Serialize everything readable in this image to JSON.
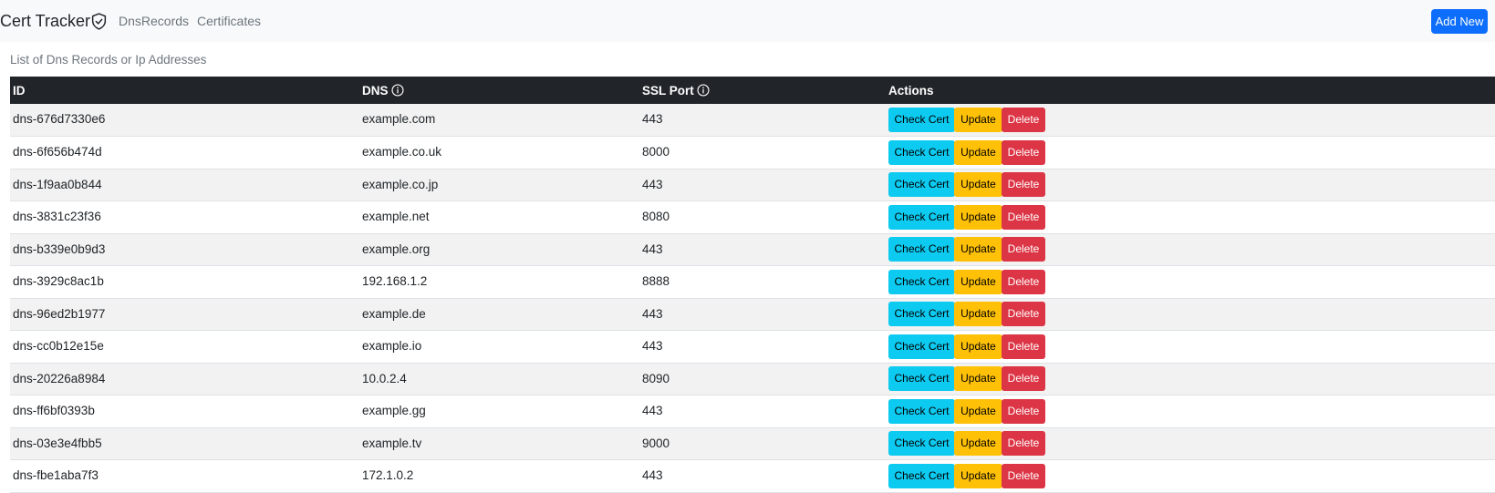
{
  "navbar": {
    "brand": "Cert Tracker",
    "brand_icon": "shield-check-icon",
    "links": [
      "DnsRecords",
      "Certificates"
    ],
    "add_new_label": "Add New"
  },
  "caption": "List of Dns Records or Ip Addresses",
  "table": {
    "headers": {
      "id": "ID",
      "dns": "DNS",
      "ssl_port": "SSL Port",
      "actions": "Actions"
    },
    "header_icons": {
      "dns": "info-circle-icon",
      "ssl_port": "info-circle-icon"
    },
    "action_labels": {
      "check": "Check Cert",
      "update": "Update",
      "delete": "Delete"
    },
    "rows": [
      {
        "id": "dns-676d7330e6",
        "dns": "example.com",
        "port": "443"
      },
      {
        "id": "dns-6f656b474d",
        "dns": "example.co.uk",
        "port": "8000"
      },
      {
        "id": "dns-1f9aa0b844",
        "dns": "example.co.jp",
        "port": "443"
      },
      {
        "id": "dns-3831c23f36",
        "dns": "example.net",
        "port": "8080"
      },
      {
        "id": "dns-b339e0b9d3",
        "dns": "example.org",
        "port": "443"
      },
      {
        "id": "dns-3929c8ac1b",
        "dns": "192.168.1.2",
        "port": "8888"
      },
      {
        "id": "dns-96ed2b1977",
        "dns": "example.de",
        "port": "443"
      },
      {
        "id": "dns-cc0b12e15e",
        "dns": "example.io",
        "port": "443"
      },
      {
        "id": "dns-20226a8984",
        "dns": "10.0.2.4",
        "port": "8090"
      },
      {
        "id": "dns-ff6bf0393b",
        "dns": "example.gg",
        "port": "443"
      },
      {
        "id": "dns-03e3e4fbb5",
        "dns": "example.tv",
        "port": "9000"
      },
      {
        "id": "dns-fbe1aba7f3",
        "dns": "172.1.0.2",
        "port": "443"
      }
    ]
  },
  "colors": {
    "primary": "#0d6efd",
    "info": "#0dcaf0",
    "warning": "#ffc107",
    "danger": "#dc3545",
    "table_header": "#212529"
  }
}
